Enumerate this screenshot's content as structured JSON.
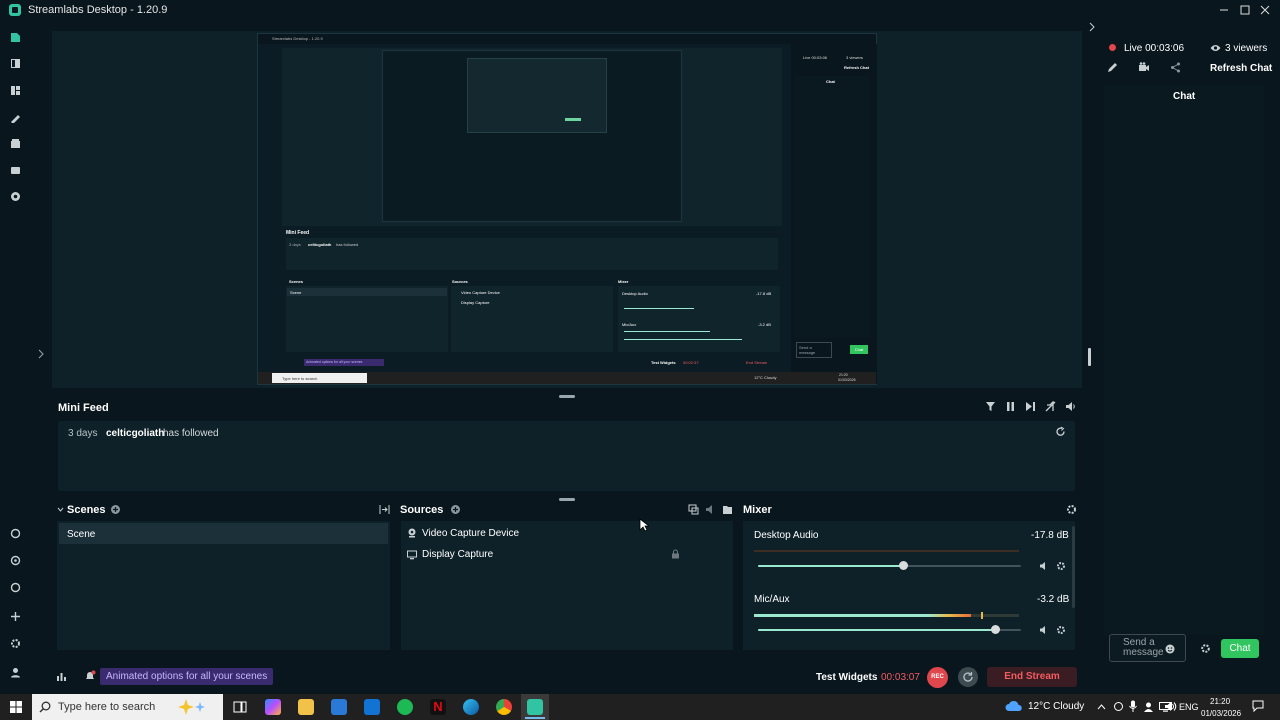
{
  "window": {
    "title": "Streamlabs Desktop - 1.20.9"
  },
  "minifeed": {
    "title": "Mini Feed",
    "events": [
      {
        "time": "3 days",
        "user": "celticgoliath",
        "action": "has followed"
      }
    ]
  },
  "scenes": {
    "title": "Scenes",
    "items": [
      "Scene"
    ]
  },
  "sources": {
    "title": "Sources",
    "items": [
      {
        "icon": "camera-icon",
        "label": "Video Capture Device"
      },
      {
        "icon": "monitor-icon",
        "label": "Display Capture"
      }
    ]
  },
  "mixer": {
    "title": "Mixer",
    "channels": [
      {
        "name": "Desktop Audio",
        "db": "-17.8 dB",
        "volume": 0.55,
        "level": 0.0
      },
      {
        "name": "Mic/Aux",
        "db": "-3.2 dB",
        "volume": 0.9,
        "level": 0.82
      }
    ]
  },
  "statusbar": {
    "promo": "Animated options for all your scenes",
    "test_widgets": "Test Widgets",
    "timer": "00:03:07",
    "rec": "REC",
    "end_stream": "End Stream"
  },
  "chat": {
    "live": "Live 00:03:06",
    "viewers": "3 viewers",
    "refresh": "Refresh Chat",
    "title": "Chat",
    "send_placeholder": "Send a message",
    "chat_button": "Chat"
  },
  "taskbar": {
    "search": "Type here to search",
    "weather": "12°C  Cloudy",
    "lang": "ENG",
    "time": "21:20",
    "date": "01/03/2026"
  },
  "nested_preview": {
    "title": "Streamlabs Desktop - 1.20.9",
    "minifeed": "Mini Feed",
    "feed_time": "3 days",
    "feed_user": "celticgoliath",
    "feed_action": "has followed",
    "scenes": "Scenes",
    "scene": "Scene",
    "sources": "Sources",
    "source1": "Video Capture Device",
    "source2": "Display Capture",
    "mixer": "Mixer",
    "desktop_audio": "Desktop Audio",
    "desktop_db": "-17.8 dB",
    "mic": "Mic/Aux",
    "mic_db": "-3.2 dB",
    "promo": "Animated options for all your scenes",
    "test_widgets": "Test Widgets",
    "timer": "00:02:37",
    "end_stream": "End Stream",
    "live": "Live 00:03:06",
    "viewers": "3 viewers",
    "refresh": "Refresh Chat",
    "chat": "Chat",
    "send": "Send a message",
    "chat_button": "Chat",
    "search": "Type here to search",
    "weather": "12°C  Cloudy",
    "time": "21:20",
    "date": "01/03/2026"
  },
  "colors": {
    "accent": "#31c3a2",
    "live": "#e0474c",
    "chat_button": "#31c55f",
    "end_stream": "#f25b60",
    "promo_bg": "#3a2a6e"
  }
}
